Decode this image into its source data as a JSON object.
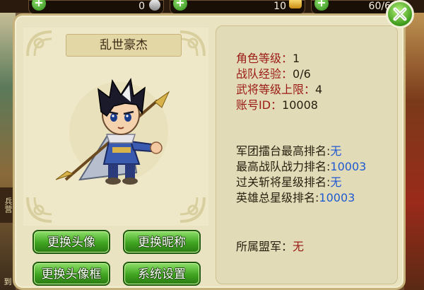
{
  "topbar": {
    "resources": [
      {
        "value": "0",
        "icon": "silver-coin-icon"
      },
      {
        "value": "10",
        "icon": "gold-ingot-icon"
      },
      {
        "value": "60/6",
        "icon": "stamina-icon"
      }
    ]
  },
  "background": {
    "left_sign": "兵营",
    "left_footer": "到"
  },
  "profile": {
    "title": "乱世豪杰",
    "stats": [
      {
        "label": "角色等级：",
        "value": "1"
      },
      {
        "label": "战队经验：",
        "value": "0/6"
      },
      {
        "label": "武将等级上限：",
        "value": "4"
      },
      {
        "label": "账号ID：",
        "value": "10008"
      }
    ],
    "rankings": [
      {
        "label": "军团擂台最高排名:",
        "value": "无"
      },
      {
        "label": "最高战队战力排名:",
        "value": "10003"
      },
      {
        "label": "过关斩将星级排名:",
        "value": "无"
      },
      {
        "label": "英雄总星级排名:",
        "value": "10003"
      }
    ],
    "alliance": {
      "label": "所属盟军：",
      "value": "无"
    }
  },
  "buttons": {
    "change_avatar": "更换头像",
    "change_nickname": "更换昵称",
    "change_avatar_frame": "更换头像框",
    "system_settings": "系统设置"
  },
  "colors": {
    "panel_bg": "#e9e3c2",
    "label_red": "#9a1a14",
    "value_blue": "#1e5ad0",
    "button_green": "#3fa420"
  }
}
